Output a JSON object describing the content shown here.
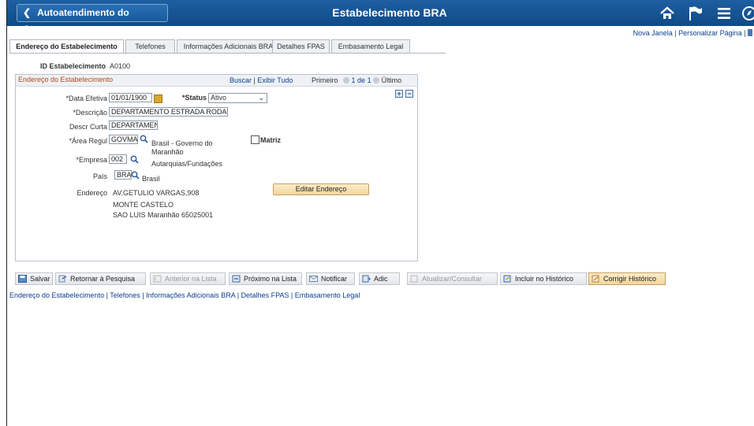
{
  "banner": {
    "back_label": "Autoatendimento do Gerente",
    "title": "Estabelecimento BRA"
  },
  "top_links": {
    "new_window": "Nova Janela",
    "personalize": "Personalizar Página"
  },
  "tabs": [
    "Endereço do Estabelecimento",
    "Telefones",
    "Informações Adicionais BRA",
    "Detalhes FPAS",
    "Embasamento Legal"
  ],
  "id": {
    "label": "ID Estabelecimento",
    "value": "A0100"
  },
  "panel": {
    "title": "Endereço do Estabelecimento",
    "find": "Buscar",
    "view_all": "Exibir Tudo",
    "first": "Primeiro",
    "count": "1 de 1",
    "last": "Último"
  },
  "form": {
    "effdt_label": "*Data Efetiva",
    "effdt_value": "01/01/1900",
    "status_label": "*Status",
    "status_value": "Ativo",
    "descr_label": "*Descrição",
    "descr_value": "DEPARTAMENTO ESTRADA RODAGEM",
    "descrshort_label": "Descr Curta",
    "descrshort_value": "DEPARTAMEN",
    "area_label": "*Área Regul",
    "area_value": "GOVMA",
    "area_desc": "Brasil - Governo do Maranhão",
    "matriz_label": "Matriz",
    "company_label": "*Empresa",
    "company_value": "002",
    "company_desc": "Autarquias/Fundações",
    "country_label": "País",
    "country_value": "BRA",
    "country_desc": "Brasil",
    "address_label": "Endereço",
    "address_lines": [
      "AV.GETULIO VARGAS,908",
      "MONTE CASTELO",
      "SAO LUIS Maranhão 65025001"
    ],
    "edit_address": "Editar Endereço"
  },
  "toolbar": {
    "save": "Salvar",
    "return": "Retornar à Pesquisa",
    "prev": "Anterior na Lista",
    "next": "Próximo na Lista",
    "notify": "Notificar",
    "add": "Adic",
    "update": "Atualizar/Consultar",
    "include_history": "Incluir no Histórico",
    "correct_history": "Corrigir Histórico"
  },
  "footer_links": [
    "Endereço do Estabelecimento",
    "Telefones",
    "Informações Adicionais BRA",
    "Detalhes FPAS",
    "Embasamento Legal"
  ],
  "colors": {
    "banner": "#0f4a86",
    "panel_title": "#b24a19",
    "link": "#0a3e8c"
  }
}
